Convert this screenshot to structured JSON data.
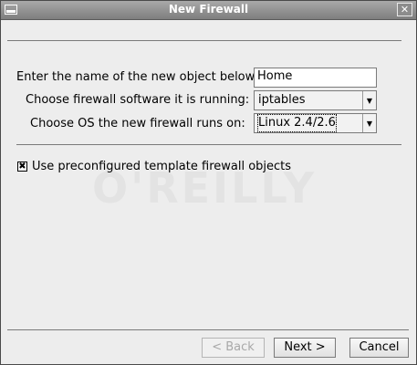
{
  "window": {
    "title": "New Firewall",
    "close_glyph": "✕"
  },
  "form": {
    "name_label": "Enter the name of the new object below:",
    "name_value": "Home",
    "software_label": "Choose firewall software it is running:",
    "software_value": "iptables",
    "os_label": "Choose OS the new firewall runs on:",
    "os_value": "Linux 2.4/2.6",
    "template_checkbox_label": "Use preconfigured template firewall objects",
    "template_checkbox_checked": true,
    "checkbox_glyph": "✖",
    "dropdown_glyph": "▼"
  },
  "watermark": {
    "text": "O'REILLY"
  },
  "buttons": {
    "back_label": "< Back",
    "next_label": "Next >",
    "cancel_label": "Cancel"
  }
}
